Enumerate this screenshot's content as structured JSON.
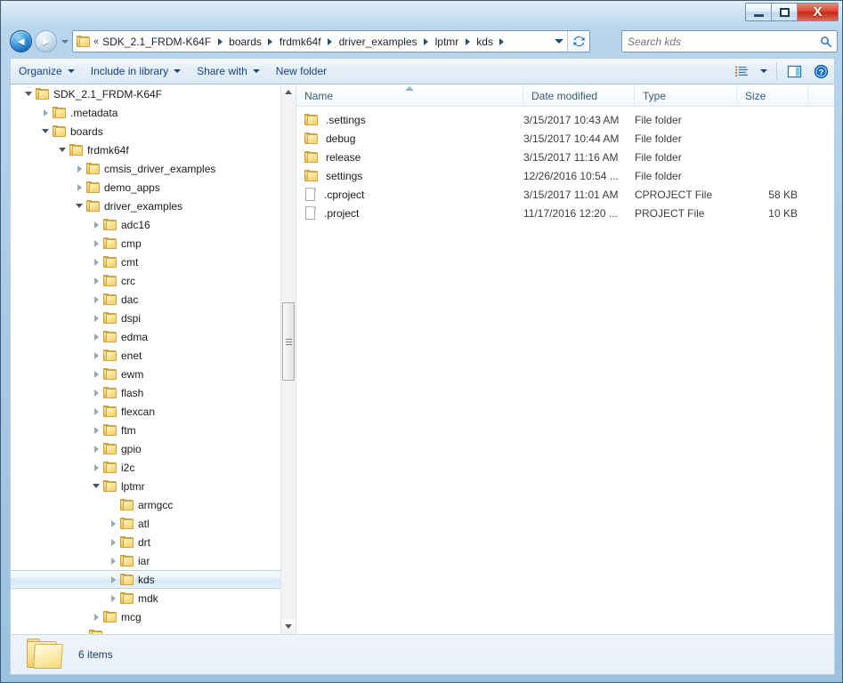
{
  "window": {
    "controls": {
      "minimize_label": "Minimize",
      "maximize_label": "Maximize",
      "close_label": "X"
    }
  },
  "navbar": {
    "back_glyph": "◄",
    "forward_glyph": "►",
    "history_label": "Recent pages",
    "address": {
      "chevrons": "«",
      "crumbs": [
        "SDK_2.1_FRDM-K64F",
        "boards",
        "frdmk64f",
        "driver_examples",
        "lptmr",
        "kds"
      ],
      "dropdown_label": "Previous locations",
      "refresh_label": "Refresh"
    },
    "search": {
      "placeholder": "Search kds",
      "value": "",
      "icon": "search-icon"
    }
  },
  "commandbar": {
    "buttons": [
      {
        "label": "Organize",
        "has_menu": true
      },
      {
        "label": "Include in library",
        "has_menu": true
      },
      {
        "label": "Share with",
        "has_menu": true
      },
      {
        "label": "New folder",
        "has_menu": false
      }
    ],
    "view_button_label": "Change your view",
    "view_menu_label": "View options",
    "preview_button_label": "Show the preview pane",
    "help_button_label": "Get help"
  },
  "tree": {
    "items": [
      {
        "label": "SDK_2.1_FRDM-K64F",
        "depth": 1,
        "state": "expanded",
        "selected": false
      },
      {
        "label": ".metadata",
        "depth": 2,
        "state": "collapsed",
        "selected": false
      },
      {
        "label": "boards",
        "depth": 2,
        "state": "expanded",
        "selected": false
      },
      {
        "label": "frdmk64f",
        "depth": 3,
        "state": "expanded",
        "selected": false
      },
      {
        "label": "cmsis_driver_examples",
        "depth": 4,
        "state": "collapsed",
        "selected": false
      },
      {
        "label": "demo_apps",
        "depth": 4,
        "state": "collapsed",
        "selected": false
      },
      {
        "label": "driver_examples",
        "depth": 4,
        "state": "expanded",
        "selected": false
      },
      {
        "label": "adc16",
        "depth": 5,
        "state": "collapsed",
        "selected": false
      },
      {
        "label": "cmp",
        "depth": 5,
        "state": "collapsed",
        "selected": false
      },
      {
        "label": "cmt",
        "depth": 5,
        "state": "collapsed",
        "selected": false
      },
      {
        "label": "crc",
        "depth": 5,
        "state": "collapsed",
        "selected": false
      },
      {
        "label": "dac",
        "depth": 5,
        "state": "collapsed",
        "selected": false
      },
      {
        "label": "dspi",
        "depth": 5,
        "state": "collapsed",
        "selected": false
      },
      {
        "label": "edma",
        "depth": 5,
        "state": "collapsed",
        "selected": false
      },
      {
        "label": "enet",
        "depth": 5,
        "state": "collapsed",
        "selected": false
      },
      {
        "label": "ewm",
        "depth": 5,
        "state": "collapsed",
        "selected": false
      },
      {
        "label": "flash",
        "depth": 5,
        "state": "collapsed",
        "selected": false
      },
      {
        "label": "flexcan",
        "depth": 5,
        "state": "collapsed",
        "selected": false
      },
      {
        "label": "ftm",
        "depth": 5,
        "state": "collapsed",
        "selected": false
      },
      {
        "label": "gpio",
        "depth": 5,
        "state": "collapsed",
        "selected": false
      },
      {
        "label": "i2c",
        "depth": 5,
        "state": "collapsed",
        "selected": false
      },
      {
        "label": "lptmr",
        "depth": 5,
        "state": "expanded",
        "selected": false
      },
      {
        "label": "armgcc",
        "depth": 6,
        "state": "leaf",
        "selected": false
      },
      {
        "label": "atl",
        "depth": 6,
        "state": "collapsed",
        "selected": false
      },
      {
        "label": "drt",
        "depth": 6,
        "state": "collapsed",
        "selected": false
      },
      {
        "label": "iar",
        "depth": 6,
        "state": "collapsed",
        "selected": false
      },
      {
        "label": "kds",
        "depth": 6,
        "state": "collapsed",
        "selected": true
      },
      {
        "label": "mdk",
        "depth": 6,
        "state": "collapsed",
        "selected": false
      },
      {
        "label": "mcg",
        "depth": 5,
        "state": "collapsed",
        "selected": false
      }
    ],
    "scrollbar": {
      "up_label": "Scroll up",
      "down_label": "Scroll down",
      "thumb_label": "Scroll thumb"
    }
  },
  "filelist": {
    "columns": [
      {
        "key": "name",
        "label": "Name",
        "sorted": "asc"
      },
      {
        "key": "date",
        "label": "Date modified",
        "sorted": ""
      },
      {
        "key": "type",
        "label": "Type",
        "sorted": ""
      },
      {
        "key": "size",
        "label": "Size",
        "sorted": ""
      }
    ],
    "rows": [
      {
        "icon": "folder-icon",
        "name": ".settings",
        "date": "3/15/2017 10:43 AM",
        "type": "File folder",
        "size": ""
      },
      {
        "icon": "folder-icon",
        "name": "debug",
        "date": "3/15/2017 10:44 AM",
        "type": "File folder",
        "size": ""
      },
      {
        "icon": "folder-icon",
        "name": "release",
        "date": "3/15/2017 11:16 AM",
        "type": "File folder",
        "size": ""
      },
      {
        "icon": "folder-icon",
        "name": "settings",
        "date": "12/26/2016 10:54 ...",
        "type": "File folder",
        "size": ""
      },
      {
        "icon": "file-icon",
        "name": ".cproject",
        "date": "3/15/2017 11:01 AM",
        "type": "CPROJECT File",
        "size": "58 KB"
      },
      {
        "icon": "file-icon",
        "name": ".project",
        "date": "11/17/2016 12:20 ...",
        "type": "PROJECT File",
        "size": "10 KB"
      }
    ]
  },
  "statusbar": {
    "item_count_text": "6 items",
    "folder_icon": "folder-icon-large"
  },
  "colors": {
    "accent": "#15428b",
    "frame": "#a9cbe6",
    "selection": "#d4e7f8",
    "folder_yellow": "#f6d069",
    "close_red": "#d9452f"
  }
}
